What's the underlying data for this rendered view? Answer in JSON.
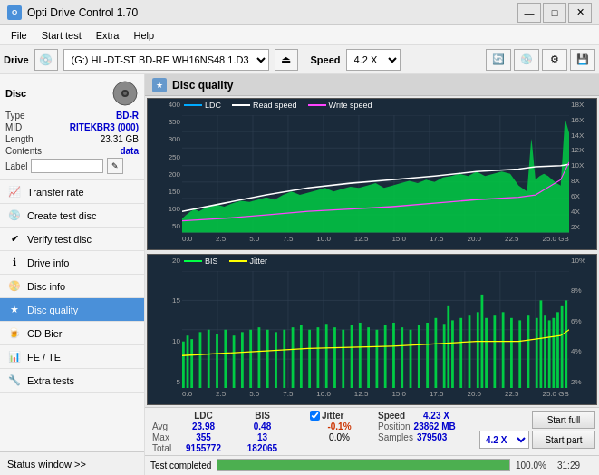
{
  "app": {
    "title": "Opti Drive Control 1.70",
    "icon": "O"
  },
  "titlebar": {
    "minimize": "—",
    "maximize": "□",
    "close": "✕"
  },
  "menubar": {
    "items": [
      "File",
      "Start test",
      "Extra",
      "Help"
    ]
  },
  "drivebar": {
    "drive_label": "Drive",
    "drive_value": "(G:) HL-DT-ST BD-RE  WH16NS48 1.D3",
    "speed_label": "Speed",
    "speed_value": "4.2 X"
  },
  "disc": {
    "title": "Disc",
    "type_label": "Type",
    "type_value": "BD-R",
    "mid_label": "MID",
    "mid_value": "RITEKBR3 (000)",
    "length_label": "Length",
    "length_value": "23.31 GB",
    "contents_label": "Contents",
    "contents_value": "data",
    "label_label": "Label"
  },
  "sidebar": {
    "items": [
      {
        "id": "transfer-rate",
        "label": "Transfer rate",
        "icon": "📈"
      },
      {
        "id": "create-test-disc",
        "label": "Create test disc",
        "icon": "💿"
      },
      {
        "id": "verify-test-disc",
        "label": "Verify test disc",
        "icon": "✔"
      },
      {
        "id": "drive-info",
        "label": "Drive info",
        "icon": "ℹ"
      },
      {
        "id": "disc-info",
        "label": "Disc info",
        "icon": "📀"
      },
      {
        "id": "disc-quality",
        "label": "Disc quality",
        "icon": "★",
        "active": true
      },
      {
        "id": "cd-bier",
        "label": "CD Bier",
        "icon": "🍺"
      },
      {
        "id": "fe-te",
        "label": "FE / TE",
        "icon": "📊"
      },
      {
        "id": "extra-tests",
        "label": "Extra tests",
        "icon": "🔧"
      }
    ],
    "status_window": "Status window >>"
  },
  "disc_quality": {
    "title": "Disc quality",
    "chart1": {
      "legend": [
        {
          "label": "LDC",
          "color": "#00aaff"
        },
        {
          "label": "Read speed",
          "color": "#ffffff"
        },
        {
          "label": "Write speed",
          "color": "#ff44ff"
        }
      ],
      "y_left": [
        "400",
        "350",
        "300",
        "250",
        "200",
        "150",
        "100",
        "50"
      ],
      "y_right": [
        "18X",
        "16X",
        "14X",
        "12X",
        "10X",
        "8X",
        "6X",
        "4X",
        "2X"
      ],
      "x_labels": [
        "0.0",
        "2.5",
        "5.0",
        "7.5",
        "10.0",
        "12.5",
        "15.0",
        "17.5",
        "20.0",
        "22.5",
        "25.0 GB"
      ]
    },
    "chart2": {
      "legend": [
        {
          "label": "BIS",
          "color": "#00ff44"
        },
        {
          "label": "Jitter",
          "color": "#ffff00"
        }
      ],
      "y_left": [
        "20",
        "15",
        "10",
        "5"
      ],
      "y_right": [
        "10%",
        "8%",
        "6%",
        "4%",
        "2%"
      ],
      "x_labels": [
        "0.0",
        "2.5",
        "5.0",
        "7.5",
        "10.0",
        "12.5",
        "15.0",
        "17.5",
        "20.0",
        "22.5",
        "25.0 GB"
      ]
    }
  },
  "stats": {
    "headers": [
      "LDC",
      "BIS",
      "",
      "Jitter",
      "Speed",
      "",
      ""
    ],
    "avg_label": "Avg",
    "avg_ldc": "23.98",
    "avg_bis": "0.48",
    "avg_jitter": "-0.1%",
    "max_label": "Max",
    "max_ldc": "355",
    "max_bis": "13",
    "max_jitter": "0.0%",
    "total_label": "Total",
    "total_ldc": "9155772",
    "total_bis": "182065",
    "speed_label": "Speed",
    "speed_value": "4.23 X",
    "position_label": "Position",
    "position_value": "23862 MB",
    "samples_label": "Samples",
    "samples_value": "379503",
    "jitter_checked": true,
    "jitter_label": "Jitter",
    "speed_dropdown": "4.2 X",
    "start_full": "Start full",
    "start_part": "Start part"
  },
  "progress": {
    "percent": 100,
    "percent_label": "100.0%",
    "status": "Test completed",
    "time": "31:29"
  }
}
